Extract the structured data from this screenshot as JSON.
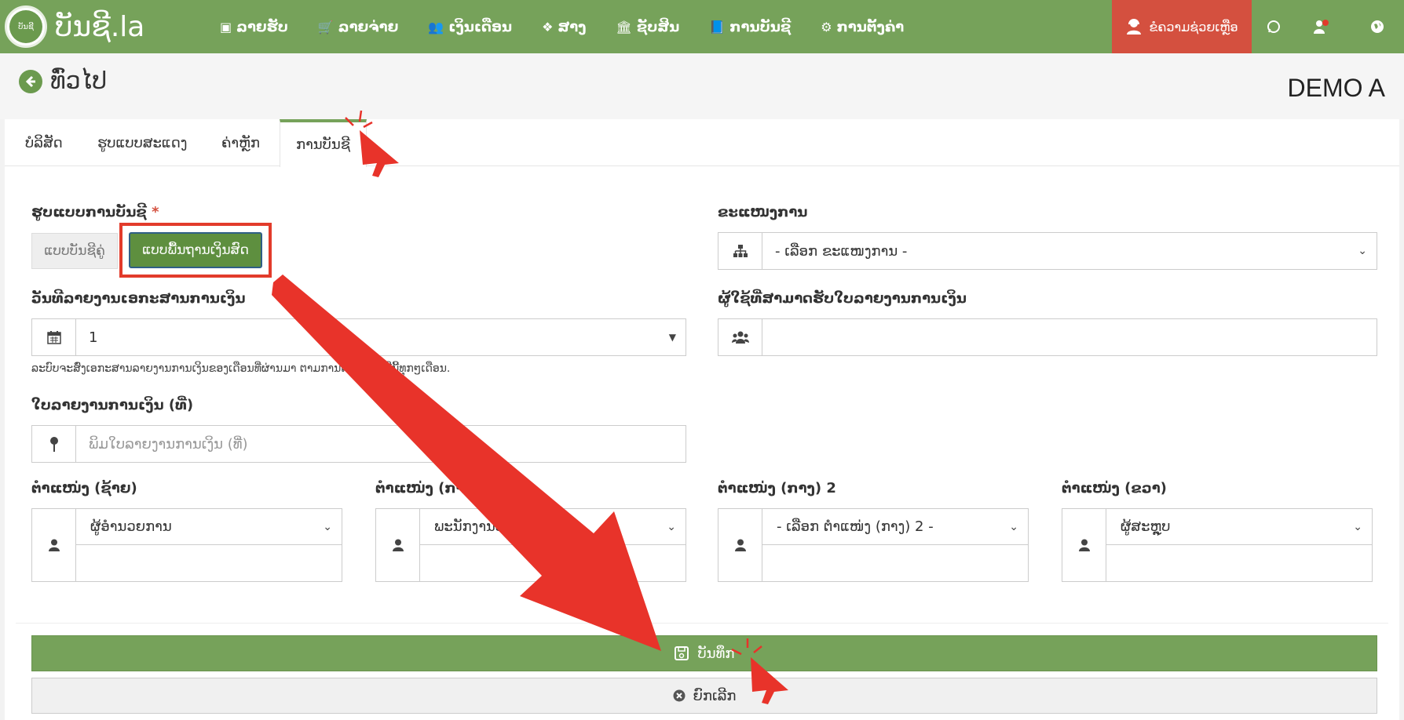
{
  "brand": {
    "logo_text": "ບັນຊີ.la",
    "logo_badge": "ບັນຊີ"
  },
  "nav": [
    {
      "icon": "money-icon",
      "glyph": "▣",
      "label": "ລາຍຮັບ"
    },
    {
      "icon": "cart-icon",
      "glyph": "🛒",
      "label": "ລາຍຈ່າຍ"
    },
    {
      "icon": "users-icon",
      "glyph": "👥",
      "label": "ເງິນເດືອນ"
    },
    {
      "icon": "dropbox-icon",
      "glyph": "❖",
      "label": "ສາງ"
    },
    {
      "icon": "bank-icon",
      "glyph": "🏛",
      "label": "ຊັບສິນ"
    },
    {
      "icon": "book-icon",
      "glyph": "📘",
      "label": "ການບັນຊີ"
    },
    {
      "icon": "cogs-icon",
      "glyph": "⚙",
      "label": "ການຕັ້ງຄ່າ"
    }
  ],
  "help_button": {
    "label": "ຂໍຄວາມຊ່ວຍເຫຼືອ"
  },
  "header": {
    "back_label": "ທົ່ວໄປ",
    "company": "DEMO A"
  },
  "tabs": [
    {
      "label": "ບໍລິສັດ"
    },
    {
      "label": "ຮູບແບບສະແດງ"
    },
    {
      "label": "ຄ່າຫຼັກ"
    },
    {
      "label": "ການບັນຊີ"
    }
  ],
  "form": {
    "accounting_mode": {
      "label": "ຮູບແບບການບັນຊີ",
      "required_mark": "*",
      "option_double": "ແບບບັນຊີຄູ່",
      "option_cash": "ແບບພື້ນຖານເງິນສົດ"
    },
    "department": {
      "label": "ຂະແໜງການ",
      "value": "- ເລືອກ ຂະແໜງການ -"
    },
    "report_date": {
      "label": "ວັນທີລາຍງານເອກະສານການເງິນ",
      "value": "1",
      "help": "ລະບົບຈະສົ່ງເອກະສານລາຍງານການເງິນຂອງເດືອນທີ່ຜ່ານມາ ຕາມການຕັ້ງຄ່າ ວັນທີນີ້ທຸກໆເດືອນ."
    },
    "recipients": {
      "label": "ຜູ້ໃຊ້ທີ່ສາມາດຮັບໃບລາຍງານການເງິນ",
      "value": ""
    },
    "report_no": {
      "label": "ໃບລາຍງານການເງິນ (ທີ່)",
      "placeholder": "ພິມໃບລາຍງານການເງິນ (ທີ່)"
    },
    "signatures": [
      {
        "label": "ຕໍາແໜ່ງ (ຊ້າຍ)",
        "value": "ຜູ້ອໍານວຍການ"
      },
      {
        "label": "ຕໍາແໜ່ງ (ກາງ) 1",
        "value": "ພະນັກງານບັນຊີ"
      },
      {
        "label": "ຕໍາແໜ່ງ (ກາງ) 2",
        "value": "- ເລືອກ ຕໍາແໜ່ງ (ກາງ) 2 -"
      },
      {
        "label": "ຕໍາແໜ່ງ (ຂວາ)",
        "value": "ຜູ້ສະຫຼຸບ"
      }
    ]
  },
  "actions": {
    "save_label": "ບັນທຶກ",
    "cancel_label": "ຍົກເລີກ"
  },
  "colors": {
    "brand_green": "#76a25a",
    "help_red": "#d4503f",
    "annotation_red": "#e23b2b"
  }
}
